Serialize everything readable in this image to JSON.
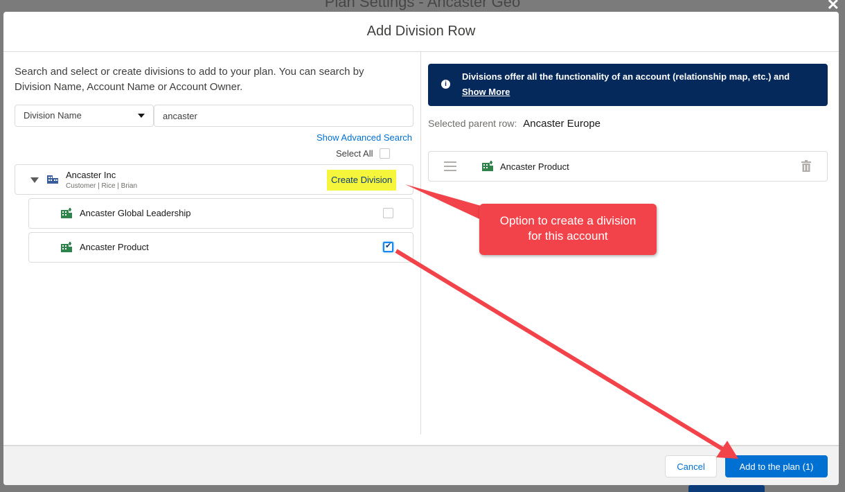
{
  "backdrop": {
    "title": "Plan Settings - Ancaster Geo",
    "close_icon": "close-icon"
  },
  "modal": {
    "title": "Add Division Row"
  },
  "left": {
    "intro": "Search and select or create divisions to add to your plan. You can search by Division Name, Account Name or Account Owner.",
    "search_field_selected": "Division Name",
    "search_value": "ancaster",
    "advanced_search_link": "Show Advanced Search",
    "select_all_label": "Select All",
    "account": {
      "name": "Ancaster Inc",
      "meta": "Customer | Rice | Brian",
      "create_division_label": "Create Division",
      "icon": "account-building-icon"
    },
    "divisions": [
      {
        "name": "Ancaster Global Leadership",
        "checked": false,
        "icon": "division-icon"
      },
      {
        "name": "Ancaster Product",
        "checked": true,
        "icon": "division-icon"
      }
    ]
  },
  "right": {
    "info_text": "Divisions offer all the functionality of an account (relationship map, etc.) and",
    "show_more_label": "Show More",
    "parent_label": "Selected parent row:",
    "parent_value": "Ancaster Europe",
    "selected_items": [
      {
        "name": "Ancaster Product",
        "icon": "division-icon"
      }
    ]
  },
  "callout": {
    "line1": "Option to create a division",
    "line2": "for this account"
  },
  "footer": {
    "cancel_label": "Cancel",
    "add_label": "Add to the plan (1)"
  },
  "colors": {
    "brand_blue": "#0070d2",
    "banner_navy": "#06295c",
    "highlight_yellow": "#f5f53c",
    "callout_red": "#f2434a",
    "division_green": "#2e844a"
  }
}
